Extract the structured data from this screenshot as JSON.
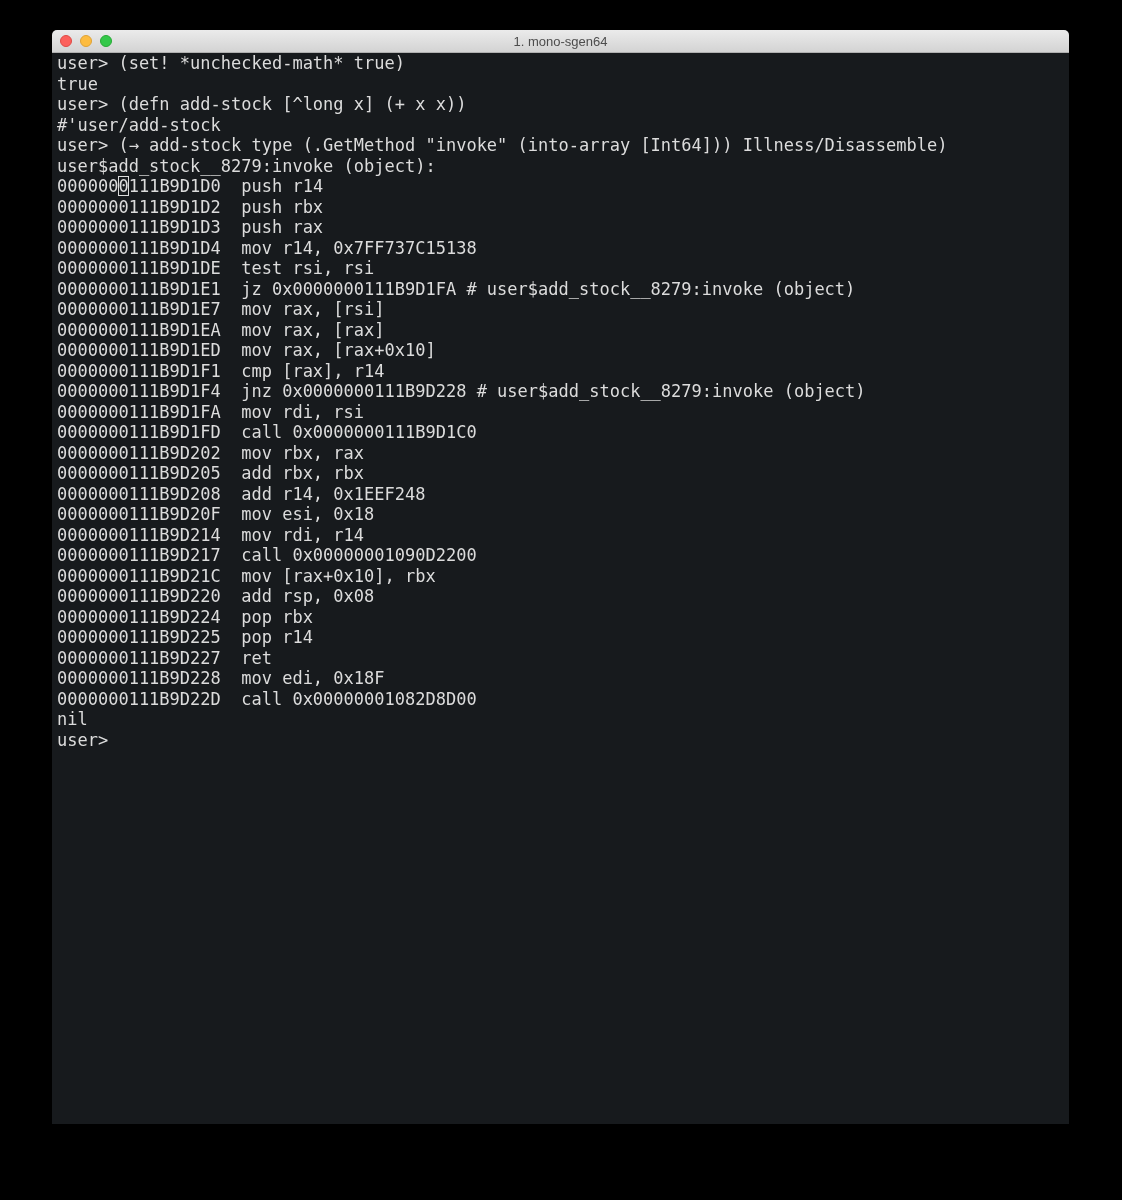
{
  "window": {
    "title": "1. mono-sgen64"
  },
  "lines": [
    {
      "text": "user> (set! *unchecked-math* true)"
    },
    {
      "text": "true"
    },
    {
      "text": "user> (defn add-stock [^long x] (+ x x))"
    },
    {
      "text": "#'user/add-stock"
    },
    {
      "text": "user> (→ add-stock type (.GetMethod \"invoke\" (into-array [Int64])) Illness/Disassemble)"
    },
    {
      "text": "user$add_stock__8279:invoke (object):"
    },
    {
      "before": "000000",
      "cursor": "0",
      "after": "111B9D1D0  push r14"
    },
    {
      "text": "0000000111B9D1D2  push rbx"
    },
    {
      "text": "0000000111B9D1D3  push rax"
    },
    {
      "text": "0000000111B9D1D4  mov r14, 0x7FF737C15138"
    },
    {
      "text": "0000000111B9D1DE  test rsi, rsi"
    },
    {
      "text": "0000000111B9D1E1  jz 0x0000000111B9D1FA # user$add_stock__8279:invoke (object)"
    },
    {
      "text": "0000000111B9D1E7  mov rax, [rsi]"
    },
    {
      "text": "0000000111B9D1EA  mov rax, [rax]"
    },
    {
      "text": "0000000111B9D1ED  mov rax, [rax+0x10]"
    },
    {
      "text": "0000000111B9D1F1  cmp [rax], r14"
    },
    {
      "text": "0000000111B9D1F4  jnz 0x0000000111B9D228 # user$add_stock__8279:invoke (object)"
    },
    {
      "text": "0000000111B9D1FA  mov rdi, rsi"
    },
    {
      "text": "0000000111B9D1FD  call 0x0000000111B9D1C0"
    },
    {
      "text": "0000000111B9D202  mov rbx, rax"
    },
    {
      "text": "0000000111B9D205  add rbx, rbx"
    },
    {
      "text": "0000000111B9D208  add r14, 0x1EEF248"
    },
    {
      "text": "0000000111B9D20F  mov esi, 0x18"
    },
    {
      "text": "0000000111B9D214  mov rdi, r14"
    },
    {
      "text": "0000000111B9D217  call 0x00000001090D2200"
    },
    {
      "text": "0000000111B9D21C  mov [rax+0x10], rbx"
    },
    {
      "text": "0000000111B9D220  add rsp, 0x08"
    },
    {
      "text": "0000000111B9D224  pop rbx"
    },
    {
      "text": "0000000111B9D225  pop r14"
    },
    {
      "text": "0000000111B9D227  ret"
    },
    {
      "text": "0000000111B9D228  mov edi, 0x18F"
    },
    {
      "text": "0000000111B9D22D  call 0x00000001082D8D00"
    },
    {
      "text": "nil"
    },
    {
      "text": "user>"
    }
  ]
}
